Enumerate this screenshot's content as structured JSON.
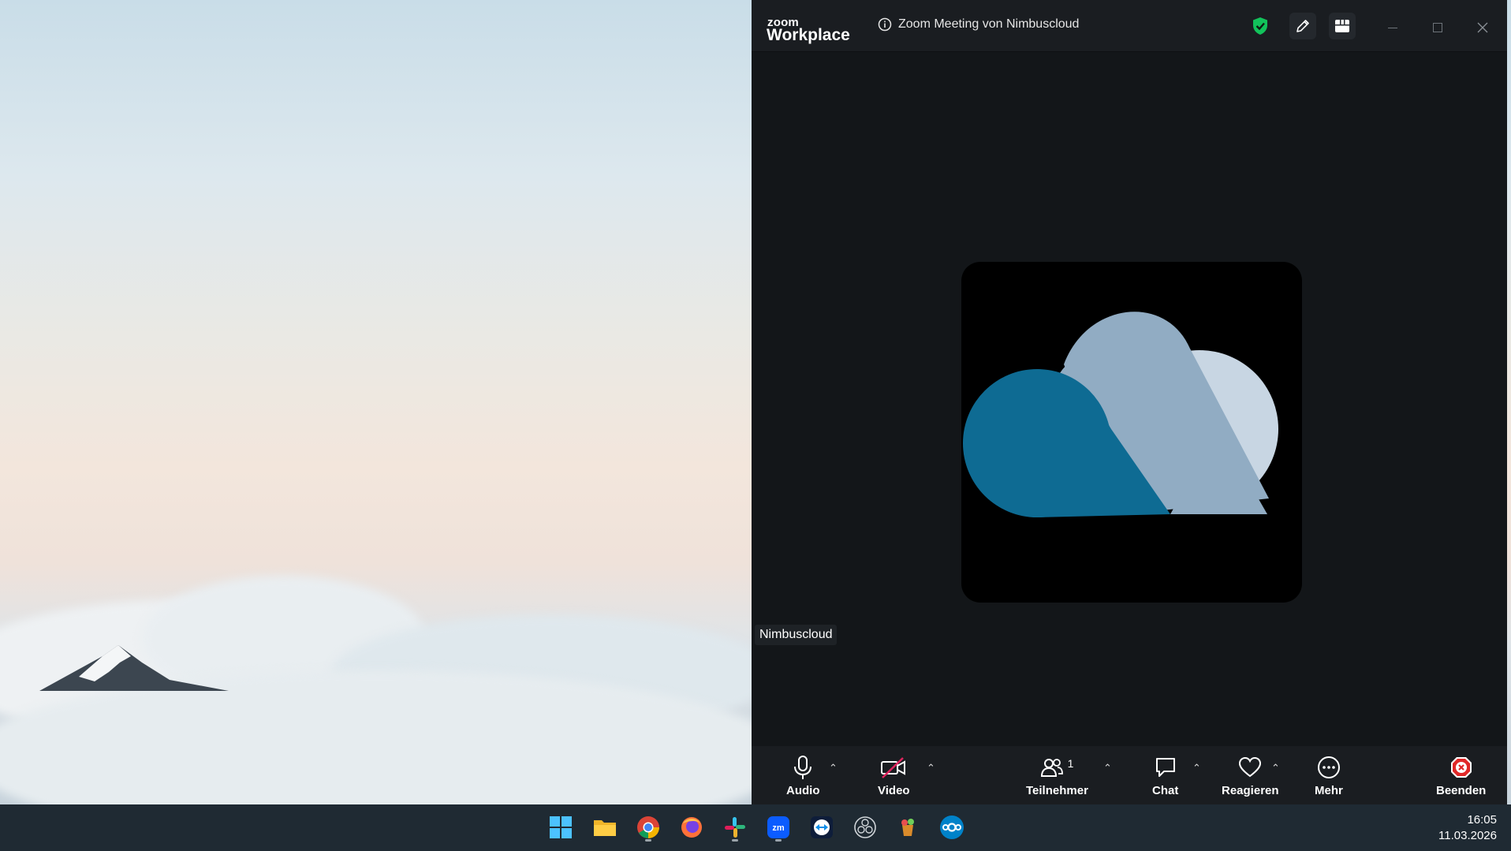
{
  "window": {
    "brand_small": "zoom",
    "brand_big": "Workplace",
    "meeting_title": "Zoom Meeting von Nimbuscloud"
  },
  "participant": {
    "name": "Nimbuscloud"
  },
  "toolbar": {
    "audio": "Audio",
    "video": "Video",
    "participants": "Teilnehmer",
    "participants_count": "1",
    "chat": "Chat",
    "react": "Reagieren",
    "more": "Mehr",
    "end": "Beenden"
  },
  "taskbar": {
    "apps": [
      "windows-start",
      "file-explorer",
      "chrome",
      "firefox",
      "slack",
      "zoom",
      "teamviewer",
      "obs",
      "app-8",
      "nextcloud"
    ],
    "time": "16:05",
    "date": "11.03.2026"
  },
  "colors": {
    "shield": "#12c25b",
    "end_red": "#e02828",
    "video_off": "#e0245e",
    "cloud_dark": "#0e6b93",
    "cloud_mid": "#91acc3",
    "cloud_light": "#c8d6e3"
  }
}
